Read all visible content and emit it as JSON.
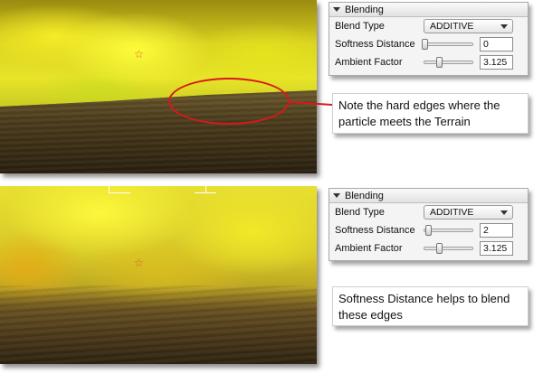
{
  "panels": [
    {
      "title": "Blending",
      "blend_type_label": "Blend Type",
      "blend_type_value": "ADDITIVE",
      "softness_label": "Softness Distance",
      "softness_value": "0",
      "softness_slider_position": 0.0,
      "ambient_label": "Ambient Factor",
      "ambient_value": "3.125",
      "ambient_slider_position": 0.3
    },
    {
      "title": "Blending",
      "blend_type_label": "Blend Type",
      "blend_type_value": "ADDITIVE",
      "softness_label": "Softness Distance",
      "softness_value": "2",
      "softness_slider_position": 0.08,
      "ambient_label": "Ambient Factor",
      "ambient_value": "3.125",
      "ambient_slider_position": 0.3
    }
  ],
  "callouts": {
    "top": "Note the hard edges where the particle meets the Terrain",
    "bottom": "Softness Distance helps to blend these edges"
  },
  "colors": {
    "highlight": "#d51a1a",
    "star_marker": "#e05a2a"
  },
  "icons": {
    "collapse": "chevron-down-icon",
    "marker": "star-marker-icon"
  }
}
